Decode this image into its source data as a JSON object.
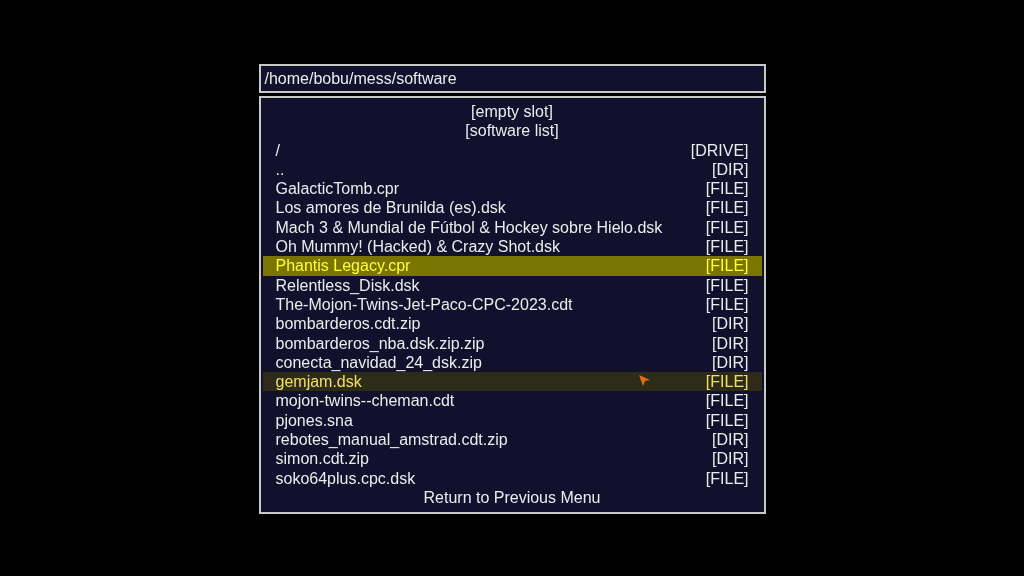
{
  "path": "/home/bobu/mess/software",
  "items": [
    {
      "kind": "center",
      "label": "[empty slot]",
      "selected": false,
      "hovered": false
    },
    {
      "kind": "center",
      "label": "[software list]",
      "selected": false,
      "hovered": false
    },
    {
      "kind": "entry",
      "label": "/",
      "type": "[DRIVE]",
      "selected": false,
      "hovered": false
    },
    {
      "kind": "entry",
      "label": "..",
      "type": "[DIR]",
      "selected": false,
      "hovered": false
    },
    {
      "kind": "entry",
      "label": "GalacticTomb.cpr",
      "type": "[FILE]",
      "selected": false,
      "hovered": false
    },
    {
      "kind": "entry",
      "label": "Los amores de Brunilda (es).dsk",
      "type": "[FILE]",
      "selected": false,
      "hovered": false
    },
    {
      "kind": "entry",
      "label": "Mach 3 & Mundial de Fútbol & Hockey sobre Hielo.dsk",
      "type": "[FILE]",
      "selected": false,
      "hovered": false
    },
    {
      "kind": "entry",
      "label": "Oh Mummy! (Hacked) & Crazy Shot.dsk",
      "type": "[FILE]",
      "selected": false,
      "hovered": false
    },
    {
      "kind": "entry",
      "label": "Phantis Legacy.cpr",
      "type": "[FILE]",
      "selected": true,
      "hovered": false
    },
    {
      "kind": "entry",
      "label": "Relentless_Disk.dsk",
      "type": "[FILE]",
      "selected": false,
      "hovered": false
    },
    {
      "kind": "entry",
      "label": "The-Mojon-Twins-Jet-Paco-CPC-2023.cdt",
      "type": "[FILE]",
      "selected": false,
      "hovered": false
    },
    {
      "kind": "entry",
      "label": "bombarderos.cdt.zip",
      "type": "[DIR]",
      "selected": false,
      "hovered": false
    },
    {
      "kind": "entry",
      "label": "bombarderos_nba.dsk.zip.zip",
      "type": "[DIR]",
      "selected": false,
      "hovered": false
    },
    {
      "kind": "entry",
      "label": "conecta_navidad_24_dsk.zip",
      "type": "[DIR]",
      "selected": false,
      "hovered": false
    },
    {
      "kind": "entry",
      "label": "gemjam.dsk",
      "type": "[FILE]",
      "selected": false,
      "hovered": true
    },
    {
      "kind": "entry",
      "label": "mojon-twins--cheman.cdt",
      "type": "[FILE]",
      "selected": false,
      "hovered": false
    },
    {
      "kind": "entry",
      "label": "pjones.sna",
      "type": "[FILE]",
      "selected": false,
      "hovered": false
    },
    {
      "kind": "entry",
      "label": "rebotes_manual_amstrad.cdt.zip",
      "type": "[DIR]",
      "selected": false,
      "hovered": false
    },
    {
      "kind": "entry",
      "label": "simon.cdt.zip",
      "type": "[DIR]",
      "selected": false,
      "hovered": false
    },
    {
      "kind": "entry",
      "label": "soko64plus.cpc.dsk",
      "type": "[FILE]",
      "selected": false,
      "hovered": false
    },
    {
      "kind": "center",
      "label": "Return to Previous Menu",
      "selected": false,
      "hovered": false
    }
  ]
}
